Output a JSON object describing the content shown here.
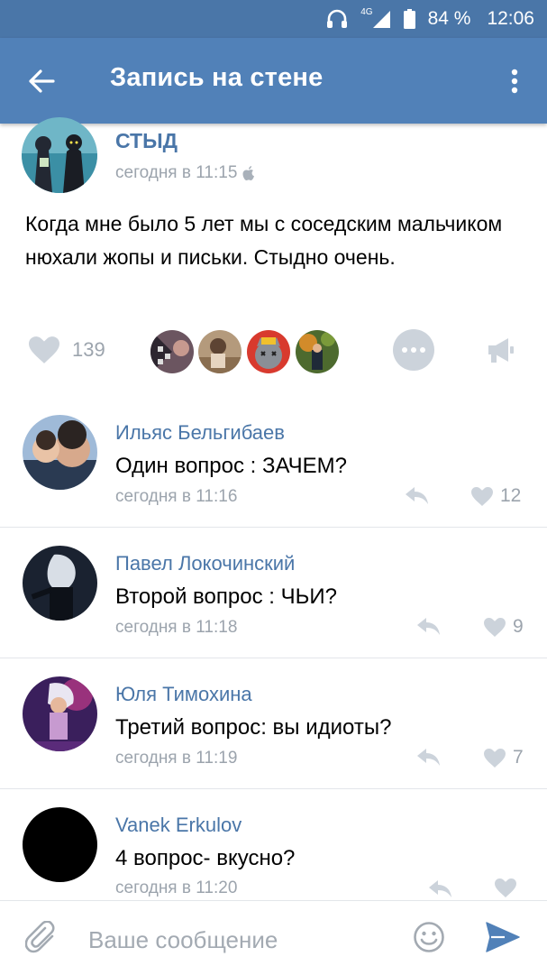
{
  "status_bar": {
    "network": "4G",
    "battery": "84 %",
    "time": "12:06"
  },
  "app_bar": {
    "title": "Запись на стене"
  },
  "post": {
    "author": "СТЫД",
    "time": "сегодня в 11:15",
    "text": "Когда мне было 5 лет мы с соседским мальчиком нюхали жопы и письки. Стыдно очень.",
    "likes": "139"
  },
  "comments": [
    {
      "author": "Ильяс Бельгибаев",
      "text": "Один вопрос : ЗАЧЕМ?",
      "time": "сегодня в 11:16",
      "likes": "12"
    },
    {
      "author": "Павел Локочинский",
      "text": "Второй вопрос : ЧЬИ?",
      "time": "сегодня в 11:18",
      "likes": "9"
    },
    {
      "author": "Юля Тимохина",
      "text": "Третий вопрос: вы идиоты?",
      "time": "сегодня в 11:19",
      "likes": "7"
    },
    {
      "author": "Vanek Erkulov",
      "text": "4 вопрос- вкусно?",
      "time": "сегодня в 11:20",
      "likes": ""
    }
  ],
  "composer": {
    "placeholder": "Ваше сообщение"
  },
  "colors": {
    "brand": "#5181b8",
    "link": "#4a76a8",
    "muted": "#9ca4ad"
  }
}
